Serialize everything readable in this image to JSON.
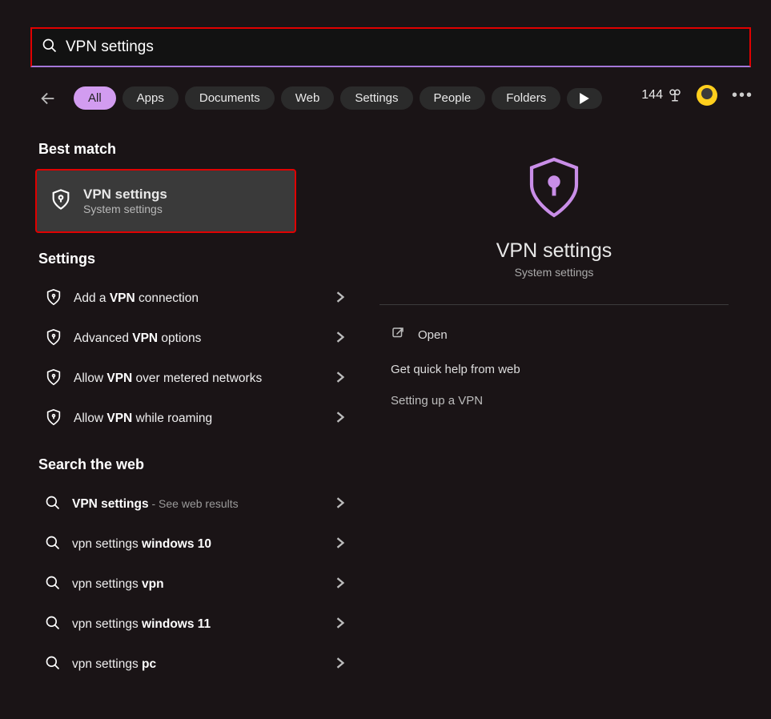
{
  "search": {
    "value": "VPN settings"
  },
  "filters": {
    "all": "All",
    "apps": "Apps",
    "documents": "Documents",
    "web": "Web",
    "settings": "Settings",
    "people": "People",
    "folders": "Folders"
  },
  "toolbar": {
    "reward_points": "144"
  },
  "sections": {
    "best_match": "Best match",
    "settings": "Settings",
    "search_web": "Search the web"
  },
  "best": {
    "title": "VPN settings",
    "subtitle": "System settings"
  },
  "settings_items": {
    "add_pre": "Add a ",
    "add_kw": "VPN",
    "add_post": " connection",
    "adv_pre": "Advanced ",
    "adv_kw": "VPN",
    "adv_post": " options",
    "metered_pre": "Allow ",
    "metered_kw": "VPN",
    "metered_post": " over metered networks",
    "roam_pre": "Allow ",
    "roam_kw": "VPN",
    "roam_post": " while roaming"
  },
  "web_items": {
    "a_kw": "VPN settings",
    "a_note": " - See web results",
    "b_pre": "vpn settings ",
    "b_kw": "windows 10",
    "c_pre": "vpn settings ",
    "c_kw": "vpn",
    "d_pre": "vpn settings ",
    "d_kw": "windows 11",
    "e_pre": "vpn settings ",
    "e_kw": "pc"
  },
  "preview": {
    "title": "VPN settings",
    "subtitle": "System settings",
    "open": "Open",
    "qh_header": "Get quick help from web",
    "qh_link": "Setting up a VPN"
  }
}
